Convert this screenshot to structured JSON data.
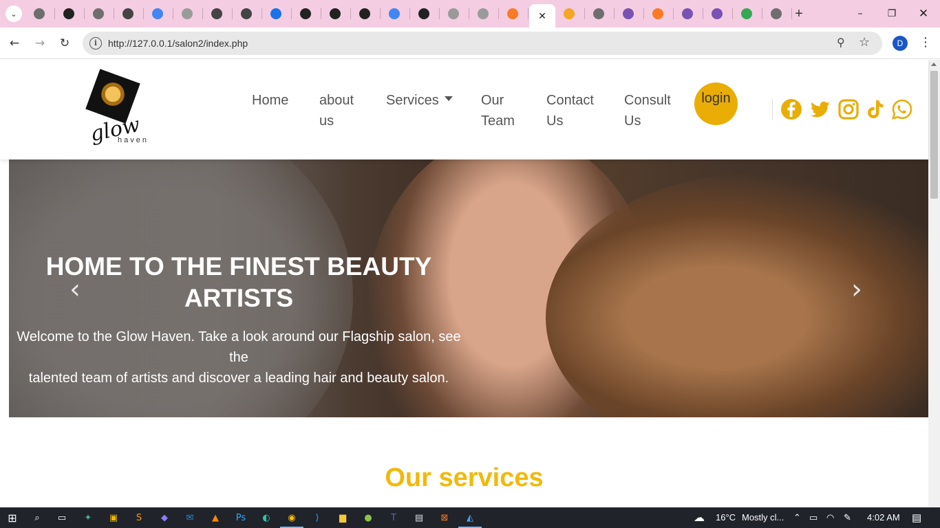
{
  "browser": {
    "tabs": [
      {
        "icon": "chrome-icon",
        "color": "#6e6e6e"
      },
      {
        "icon": "openai-icon",
        "color": "#222222"
      },
      {
        "icon": "github-icon",
        "color": "#6e6e6e"
      },
      {
        "icon": "openai-icon",
        "color": "#444444"
      },
      {
        "icon": "google-icon",
        "color": "#4285f4"
      },
      {
        "icon": "globe-icon",
        "color": "#9a9a9a"
      },
      {
        "icon": "openai-icon",
        "color": "#444444"
      },
      {
        "icon": "openai-icon",
        "color": "#444444"
      },
      {
        "icon": "gear-icon",
        "color": "#1a73e8"
      },
      {
        "icon": "openai-icon",
        "color": "#222222"
      },
      {
        "icon": "openai-icon",
        "color": "#222222"
      },
      {
        "icon": "openai-icon",
        "color": "#222222"
      },
      {
        "icon": "google-icon",
        "color": "#4285f4"
      },
      {
        "icon": "openai-icon",
        "color": "#222222"
      },
      {
        "icon": "globe-icon",
        "color": "#9a9a9a"
      },
      {
        "icon": "globe-icon",
        "color": "#9a9a9a"
      },
      {
        "icon": "xampp-icon",
        "color": "#fb7a24"
      }
    ],
    "tabs_after": [
      {
        "icon": "phpmyadmin-icon",
        "color": "#f5a623"
      },
      {
        "icon": "chrome-icon",
        "color": "#6e6e6e"
      },
      {
        "icon": "bootstrap-icon",
        "color": "#7952b3"
      },
      {
        "icon": "xampp-icon",
        "color": "#fb7a24"
      },
      {
        "icon": "bootstrap-icon",
        "color": "#7952b3"
      },
      {
        "icon": "bootstrap-icon",
        "color": "#7952b3"
      },
      {
        "icon": "drive-icon",
        "color": "#34a853"
      },
      {
        "icon": "chrome-icon",
        "color": "#6e6e6e"
      }
    ],
    "active_tab_close": "✕",
    "new_tab": "+",
    "url": "http://127.0.0.1/salon2/index.php",
    "profile_initial": "D"
  },
  "site": {
    "logo_text": "glow",
    "logo_sub": "haven",
    "nav": {
      "home": "Home",
      "about_1": "about",
      "about_2": "us",
      "services": "Services",
      "team_1": "Our",
      "team_2": "Team",
      "contact_1": "Contact",
      "contact_2": "Us",
      "consult_1": "Consult",
      "consult_2": "Us",
      "login": "login"
    },
    "social": [
      "facebook-icon",
      "twitter-icon",
      "instagram-icon",
      "tiktok-icon",
      "whatsapp-icon"
    ],
    "accent": "#e9ad05",
    "hero": {
      "title_1": "HOME TO THE FINEST BEAUTY",
      "title_2": "ARTISTS",
      "text_1": "Welcome to the Glow Haven. Take a look around our Flagship salon, see the",
      "text_2": "talented team of artists and discover a leading hair and beauty salon."
    },
    "services_title": "Our services"
  },
  "taskbar": {
    "weather": "16°C",
    "weather_text": "Mostly cl...",
    "time": "4:02 AM"
  }
}
